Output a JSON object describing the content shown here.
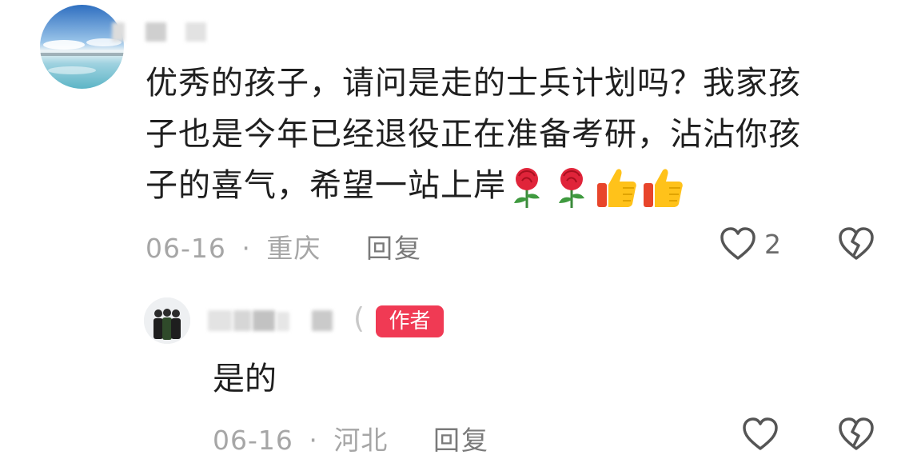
{
  "comment": {
    "text_line1": "优秀的孩子，请问是走的士兵计划吗？我家孩",
    "text_line2": "子也是今年已经退役正在准备考研，沾沾你孩",
    "text_line3": "子的喜气，希望一站上岸",
    "emojis": [
      "rose-icon",
      "rose-icon",
      "thumbs-up-icon",
      "thumbs-up-icon"
    ],
    "date": "06-16",
    "separator": "·",
    "location": "重庆",
    "reply_label": "回复",
    "like_count": "2"
  },
  "reply": {
    "badge_label": "作者",
    "paren": "(",
    "text": "是的",
    "date": "06-16",
    "separator": "·",
    "location": "河北",
    "reply_label": "回复"
  },
  "colors": {
    "badge": "#f03a54",
    "meta_text": "#a6a6a6",
    "icon_stroke": "#555555"
  }
}
